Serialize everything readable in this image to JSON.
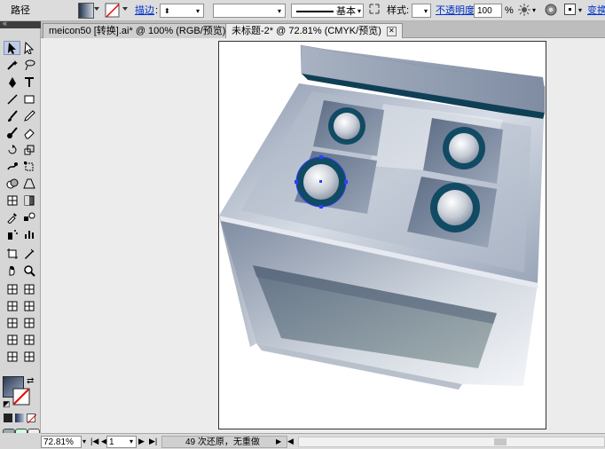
{
  "control_bar": {
    "object_type": "路径",
    "stroke_label": "描边",
    "stroke_weight": "",
    "brush_style": "基本",
    "style_label": "样式:",
    "opacity_label": "不透明度",
    "opacity_value": "100",
    "opacity_unit": "%",
    "transform_label": "变换"
  },
  "tabs": [
    {
      "label": "meicon50 [转换].ai* @ 100% (RGB/预览)",
      "active": false
    },
    {
      "label": "未标题-2* @ 72.81% (CMYK/预览)",
      "active": true
    }
  ],
  "status_bar": {
    "zoom": "72.81%",
    "page": "1",
    "history": "49 次还原，无重做"
  },
  "colors": {
    "fill_swatch": "#4d5a70",
    "stove_top_dark": "#0f3f55",
    "burner_ring": "#114a63",
    "selection_blue": "#2c3fff"
  },
  "tools": [
    "selection-icon",
    "direct-selection-icon",
    "magic-wand-icon",
    "lasso-icon",
    "pen-icon",
    "type-icon",
    "line-icon",
    "rectangle-icon",
    "paintbrush-icon",
    "pencil-icon",
    "blob-brush-icon",
    "eraser-icon",
    "rotate-icon",
    "scale-icon",
    "warp-icon",
    "free-transform-icon",
    "shape-builder-icon",
    "perspective-icon",
    "mesh-icon",
    "gradient-icon",
    "eyedropper-icon",
    "blend-icon",
    "symbol-sprayer-icon",
    "column-graph-icon",
    "artboard-icon",
    "slice-icon",
    "hand-icon",
    "zoom-icon"
  ]
}
